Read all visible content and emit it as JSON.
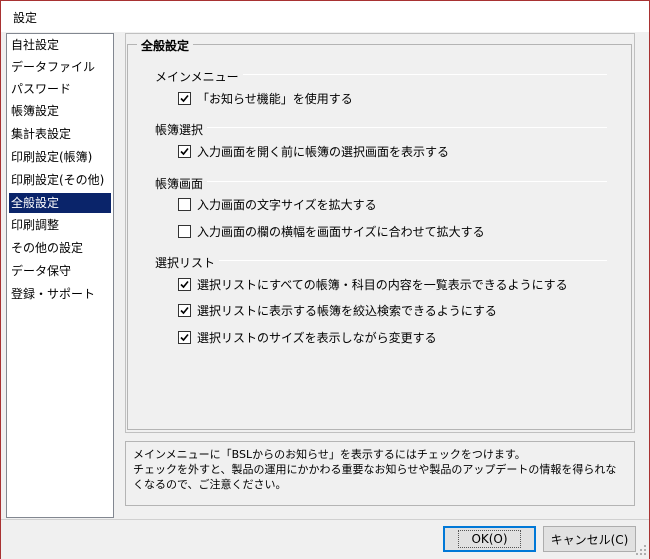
{
  "window": {
    "title": "設定"
  },
  "nav": {
    "items": [
      {
        "label": "自社設定"
      },
      {
        "label": "データファイル"
      },
      {
        "label": "パスワード"
      },
      {
        "label": "帳簿設定"
      },
      {
        "label": "集計表設定"
      },
      {
        "label": "印刷設定(帳簿)"
      },
      {
        "label": "印刷設定(その他)"
      },
      {
        "label": "全般設定",
        "selected": true
      },
      {
        "label": "印刷調整"
      },
      {
        "label": "その他の設定"
      },
      {
        "label": "データ保守"
      },
      {
        "label": "登録・サポート"
      }
    ]
  },
  "group": {
    "title": "全般設定"
  },
  "sections": [
    {
      "label": "メインメニュー",
      "options": [
        {
          "label": "「お知らせ機能」を使用する",
          "checked": true
        }
      ]
    },
    {
      "label": "帳簿選択",
      "options": [
        {
          "label": "入力画面を開く前に帳簿の選択画面を表示する",
          "checked": true
        }
      ]
    },
    {
      "label": "帳簿画面",
      "options": [
        {
          "label": "入力画面の文字サイズを拡大する",
          "checked": false
        },
        {
          "label": "入力画面の欄の横幅を画面サイズに合わせて拡大する",
          "checked": false
        }
      ]
    },
    {
      "label": "選択リスト",
      "options": [
        {
          "label": "選択リストにすべての帳簿・科目の内容を一覧表示できるようにする",
          "checked": true
        },
        {
          "label": "選択リストに表示する帳簿を絞込検索できるようにする",
          "checked": true
        },
        {
          "label": "選択リストのサイズを表示しながら変更する",
          "checked": true
        }
      ]
    }
  ],
  "help": {
    "lines": [
      "メインメニューに「BSLからのお知らせ」を表示するにはチェックをつけます。",
      "チェックを外すと、製品の運用にかかわる重要なお知らせや製品のアップデートの情報を得られな",
      "くなるので、ご注意ください。"
    ]
  },
  "buttons": {
    "ok_label": "OK(O)",
    "cancel_label": "キャンセル(C)"
  }
}
